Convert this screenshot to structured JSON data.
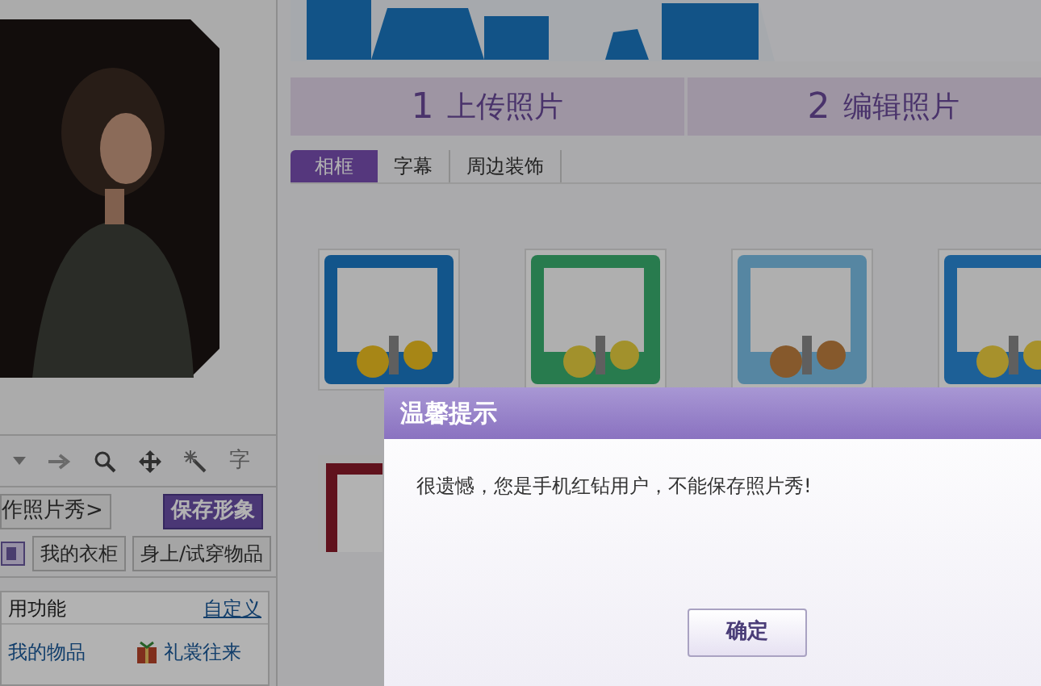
{
  "left_panel": {
    "toolbar": {
      "text_tool": "字"
    },
    "buttons": [
      {
        "label": "作照片秀>",
        "kind": "plain"
      },
      {
        "label": "保存形象",
        "kind": "primary"
      }
    ],
    "wardrobe": [
      {
        "label": "我的衣柜",
        "kind": "icon"
      },
      {
        "label": "身上/试穿物品",
        "kind": "plain"
      }
    ],
    "functions": {
      "title": "用功能",
      "customize": "自定义",
      "items": [
        "我的物品",
        "礼裳往来"
      ]
    }
  },
  "steps": [
    {
      "number": "1",
      "label": "上传照片"
    },
    {
      "number": "2",
      "label": "编辑照片"
    }
  ],
  "tabs": [
    {
      "label": "相框",
      "selected": true
    },
    {
      "label": "字幕",
      "selected": false
    },
    {
      "label": "周边装饰",
      "selected": false
    }
  ],
  "dialog": {
    "title": "温馨提示",
    "message": "很遗憾，您是手机红钻用户，不能保存照片秀!",
    "button": "确定"
  }
}
